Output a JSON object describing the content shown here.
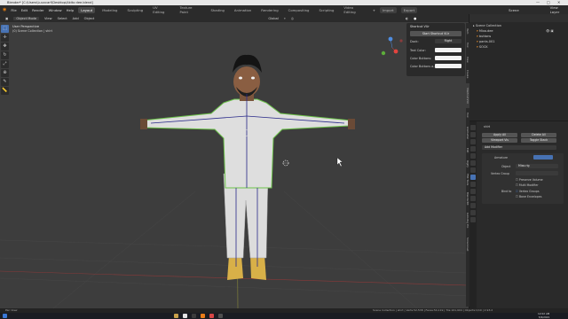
{
  "window": {
    "title": "Blender* [C:\\Users\\Luuvcarf\\Desktop\\Akito dee.blend]",
    "controls": [
      "—",
      "□",
      "✕"
    ]
  },
  "menu": {
    "items": [
      "File",
      "Edit",
      "Render",
      "Window",
      "Help"
    ],
    "workspaces": [
      "Layout",
      "Modeling",
      "Sculpting",
      "UV Editing",
      "Texture Paint",
      "Shading",
      "Animation",
      "Rendering",
      "Compositing",
      "Scripting",
      "Video Editing"
    ],
    "active_workspace": "Layout",
    "import_label": "Import",
    "export_label": "Export",
    "scene": "Scene",
    "view_layer": "View Layer"
  },
  "viewport_header": {
    "mode": "Object Mode",
    "menus": [
      "View",
      "Select",
      "Add",
      "Object"
    ],
    "transform": "Global"
  },
  "viewport": {
    "overlay_title": "User Perspective",
    "overlay_subtitle": "(0) Scene Collection | shirt"
  },
  "shortcut_vur": {
    "title": "Shortcut VUr",
    "start_button": "Start Shortcut VUr",
    "dock_label": "Dock:",
    "dock_value": "Right",
    "text_color": "Text Color:",
    "color_buttons": "Color Buttons:",
    "color_buttons_a": "Color Buttons a..."
  },
  "sidebar_tabs": [
    "Item",
    "Tool",
    "View",
    "Create",
    "Shortcut VUr",
    "Tool",
    "Animation",
    "Edit",
    "Rigify",
    "FBX Tools",
    "BlenderKit",
    "Auto-Rig Pro",
    "Screencast"
  ],
  "outliner": {
    "items": [
      {
        "label": "Scene Collection",
        "indent": 0
      },
      {
        "label": "Mixo.dee",
        "indent": 1
      },
      {
        "label": "buttons",
        "indent": 1
      },
      {
        "label": "pants.001",
        "indent": 1
      },
      {
        "label": "SOCK",
        "indent": 1
      }
    ]
  },
  "properties": {
    "object_name": "shirt",
    "apply_all": "Apply All",
    "delete_all": "Delete All",
    "viewport_vis": "Viewport Vis",
    "toggle_stack": "Toggle Stack",
    "add_modifier": "Add Modifier",
    "modifier_name": "Armature",
    "object_label": "Object",
    "object_value": "Mixo.rig",
    "vertex_group_label": "Vertex Group",
    "preserve_volume": "Preserve Volume",
    "multi_modifier": "Multi Modifier",
    "bind_to": "Bind to",
    "vertex_groups": "Vertex Groups",
    "bone_envelopes": "Bone Envelopes"
  },
  "statusbar": {
    "left": "Pan View",
    "right": "Scene Collection | shirt | Verts:52,538 | Faces:54,119 | Tris:101,904 | Objects:1/10 | 2.93.2"
  },
  "taskbar": {
    "time": "12:02 AM",
    "date": "5/9/2021"
  },
  "colors": {
    "viewport_bg": "#3d3d3d",
    "accent": "#4772b3",
    "selection_outline": "#6cc24a",
    "bone": "#2a2a8a"
  }
}
